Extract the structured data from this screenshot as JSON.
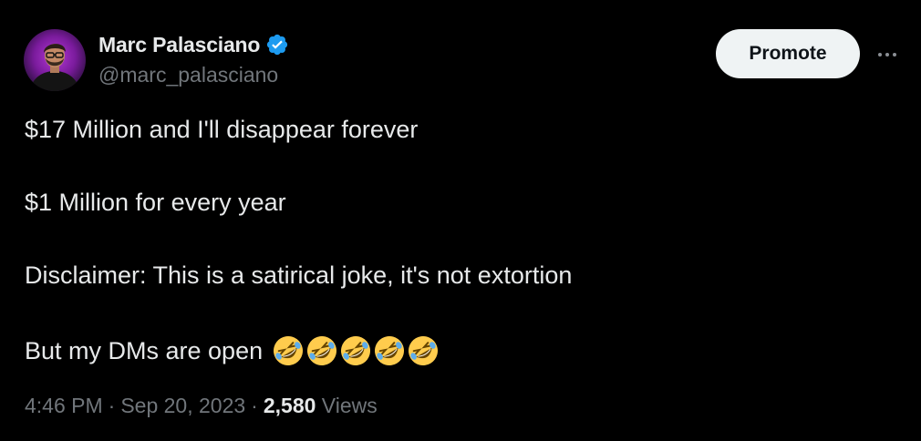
{
  "author": {
    "display_name": "Marc Palasciano",
    "handle": "@marc_palasciano",
    "verified": true,
    "verified_color": "#1d9bf0"
  },
  "actions": {
    "promote_label": "Promote",
    "more_icon": "more-horizontal-icon"
  },
  "tweet": {
    "lines": [
      "$17 Million and I'll disappear forever",
      "$1 Million for every year",
      "Disclaimer: This is a satirical joke, it's not extortion",
      "But my DMs are open"
    ],
    "emojis": [
      "rolling-on-floor-laughing",
      "rolling-on-floor-laughing",
      "rolling-on-floor-laughing",
      "rolling-on-floor-laughing",
      "rolling-on-floor-laughing"
    ]
  },
  "meta": {
    "time": "4:46 PM",
    "separator": "·",
    "date": "Sep 20, 2023",
    "views_count": "2,580",
    "views_label": "Views"
  },
  "colors": {
    "background": "#000000",
    "primary_text": "#e7e9ea",
    "secondary_text": "#71767b",
    "button_bg": "#eff3f4"
  }
}
